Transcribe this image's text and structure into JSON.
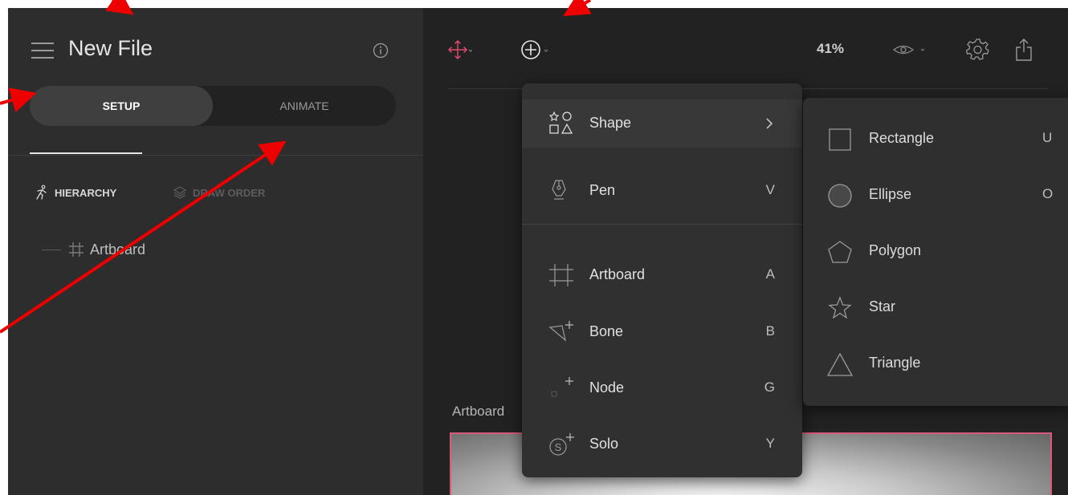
{
  "app": {
    "title": "New File"
  },
  "mode_toggle": {
    "setup_label": "SETUP",
    "animate_label": "ANIMATE"
  },
  "panel_tabs": {
    "hierarchy_label": "HIERARCHY",
    "draw_order_label": "DRAW ORDER"
  },
  "hierarchy": {
    "items": [
      {
        "label": "Artboard",
        "icon": "artboard-grid-icon"
      }
    ]
  },
  "toolbar": {
    "zoom": "41%",
    "icons": [
      "move-icon",
      "add-circle-icon",
      "eye-icon",
      "gear-icon",
      "share-icon"
    ]
  },
  "canvas": {
    "artboard_label": "Artboard"
  },
  "add_menu": {
    "items": [
      {
        "label": "Shape",
        "shortcut": "",
        "icon": "shapes-icon",
        "has_submenu": true
      },
      {
        "label": "Pen",
        "shortcut": "V",
        "icon": "pen-icon"
      },
      {
        "label": "Artboard",
        "shortcut": "A",
        "icon": "artboard-grid-icon"
      },
      {
        "label": "Bone",
        "shortcut": "B",
        "icon": "bone-add-icon"
      },
      {
        "label": "Node",
        "shortcut": "G",
        "icon": "node-add-icon"
      },
      {
        "label": "Solo",
        "shortcut": "Y",
        "icon": "solo-add-icon"
      }
    ]
  },
  "shape_submenu": {
    "items": [
      {
        "label": "Rectangle",
        "shortcut": "U",
        "icon": "rectangle-icon"
      },
      {
        "label": "Ellipse",
        "shortcut": "O",
        "icon": "ellipse-icon"
      },
      {
        "label": "Polygon",
        "shortcut": "",
        "icon": "polygon-icon"
      },
      {
        "label": "Star",
        "shortcut": "",
        "icon": "star-icon"
      },
      {
        "label": "Triangle",
        "shortcut": "",
        "icon": "triangle-icon"
      }
    ]
  },
  "colors": {
    "accent": "#e0476a",
    "annotation_arrow": "#ee0000",
    "panel_bg": "#2d2d2d",
    "canvas_bg": "#222222"
  }
}
